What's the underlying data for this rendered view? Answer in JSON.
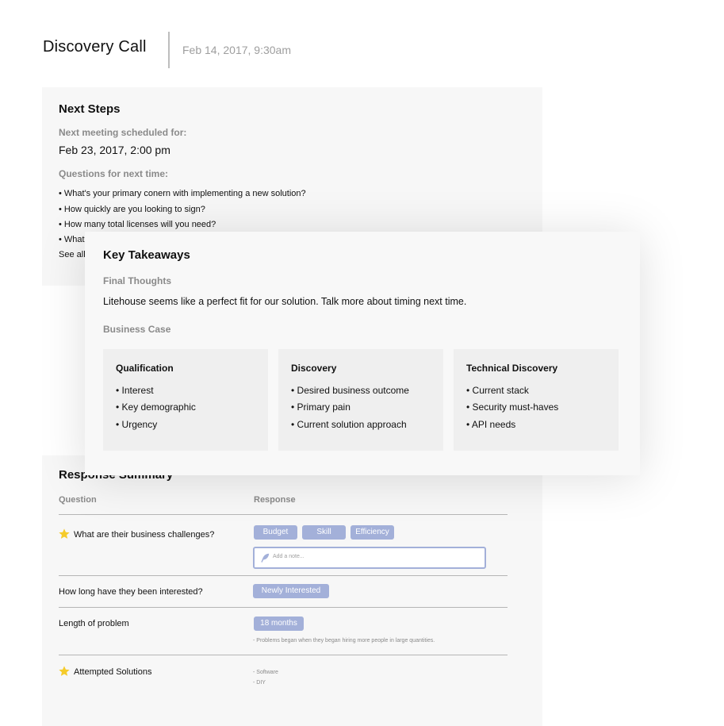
{
  "header": {
    "title": "Discovery Call",
    "date": "Feb 14, 2017, 9:30am"
  },
  "next_steps": {
    "title": "Next Steps",
    "meeting_label": "Next meeting scheduled for:",
    "meeting_date": "Feb 23, 2017, 2:00 pm",
    "questions_label": "Questions for next time:",
    "questions": [
      "• What's your primary conern with implementing a new solution?",
      "• How quickly are you looking to sign?",
      "• How many total licenses will you need?",
      "• What's"
    ],
    "see_all": "See all..."
  },
  "key_takeaways": {
    "title": "Key Takeaways",
    "final_thoughts_label": "Final Thoughts",
    "final_thoughts_text": "Litehouse seems like a perfect fit for our solution. Talk more about timing next time.",
    "business_case_label": "Business Case",
    "cards": [
      {
        "title": "Qualification",
        "items": [
          "• Interest",
          "• Key demographic",
          "• Urgency"
        ]
      },
      {
        "title": "Discovery",
        "items": [
          "• Desired business outcome",
          "• Primary pain",
          "• Current solution approach"
        ]
      },
      {
        "title": "Technical Discovery",
        "items": [
          "• Current stack",
          "• Security must-haves",
          "• API needs"
        ]
      }
    ]
  },
  "response_summary": {
    "title": "Response Summary",
    "col_question": "Question",
    "col_response": "Response",
    "rows": [
      {
        "question": "What are their business challenges?",
        "starred": true,
        "tags": [
          "Budget",
          "Skill",
          "Efficiency"
        ],
        "note_placeholder": "Add a note..."
      },
      {
        "question": "How long have they been interested?",
        "starred": false,
        "tags": [
          "Newly Interested"
        ]
      },
      {
        "question": "Length of problem",
        "starred": false,
        "tags": [
          "18 months"
        ],
        "note": "-  Problems began when they began hiring more people in large quantities."
      },
      {
        "question": "Attempted Solutions",
        "starred": true,
        "lines": [
          "- Software",
          "- DIY"
        ]
      }
    ]
  },
  "colors": {
    "tag_bg": "#a3b0d9",
    "star": "#f5cb2a",
    "card_bg": "#f7f7f7"
  }
}
